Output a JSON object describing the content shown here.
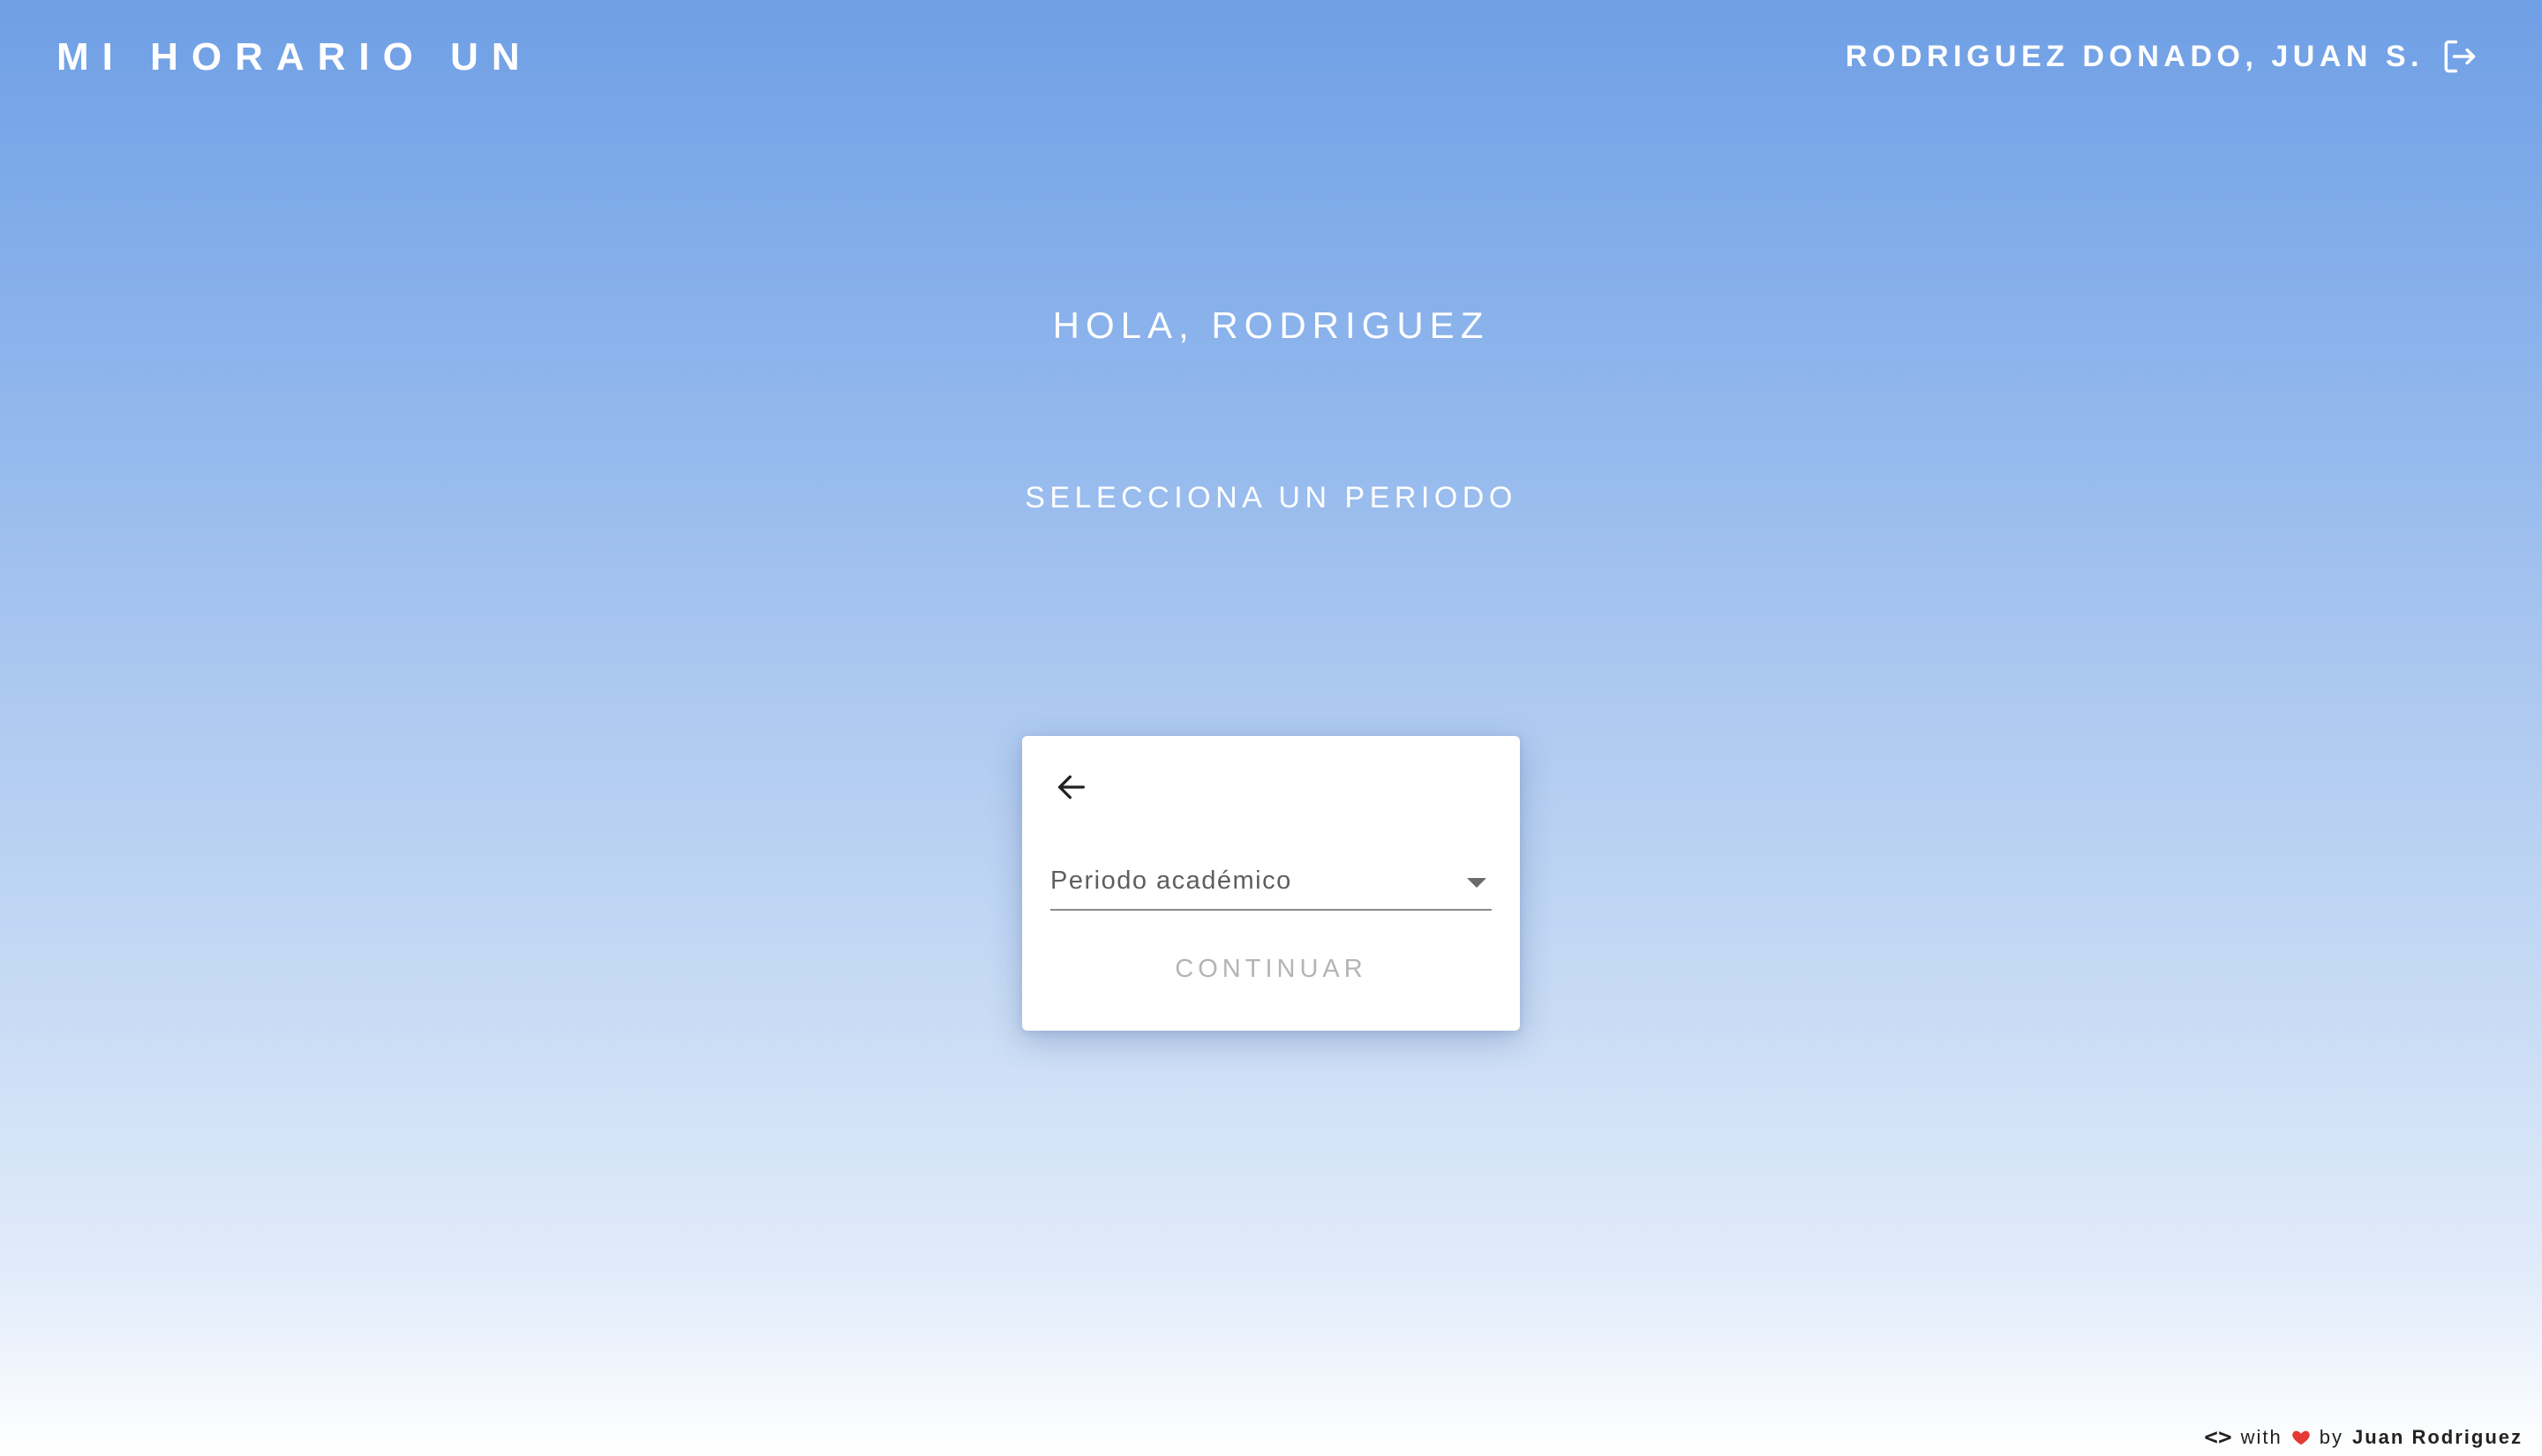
{
  "header": {
    "app_title": "MI HORARIO UN",
    "user_name": "RODRIGUEZ DONADO, JUAN S.",
    "logout_icon": "logout-icon"
  },
  "main": {
    "greeting": "HOLA, RODRIGUEZ",
    "subtitle": "SELECCIONA UN PERIODO"
  },
  "card": {
    "back_icon": "arrow-left-icon",
    "select_label": "Periodo académico",
    "continue_label": "CONTINUAR"
  },
  "footer": {
    "code_symbol": "<>",
    "with_text": "with",
    "by_text": "by",
    "author": "Juan Rodriguez",
    "heart_color": "#e53935"
  },
  "colors": {
    "gradient_top": "#6f9fe5",
    "gradient_bottom": "#ffffff",
    "card_background": "#ffffff",
    "disabled_text": "#b4b4b4"
  }
}
